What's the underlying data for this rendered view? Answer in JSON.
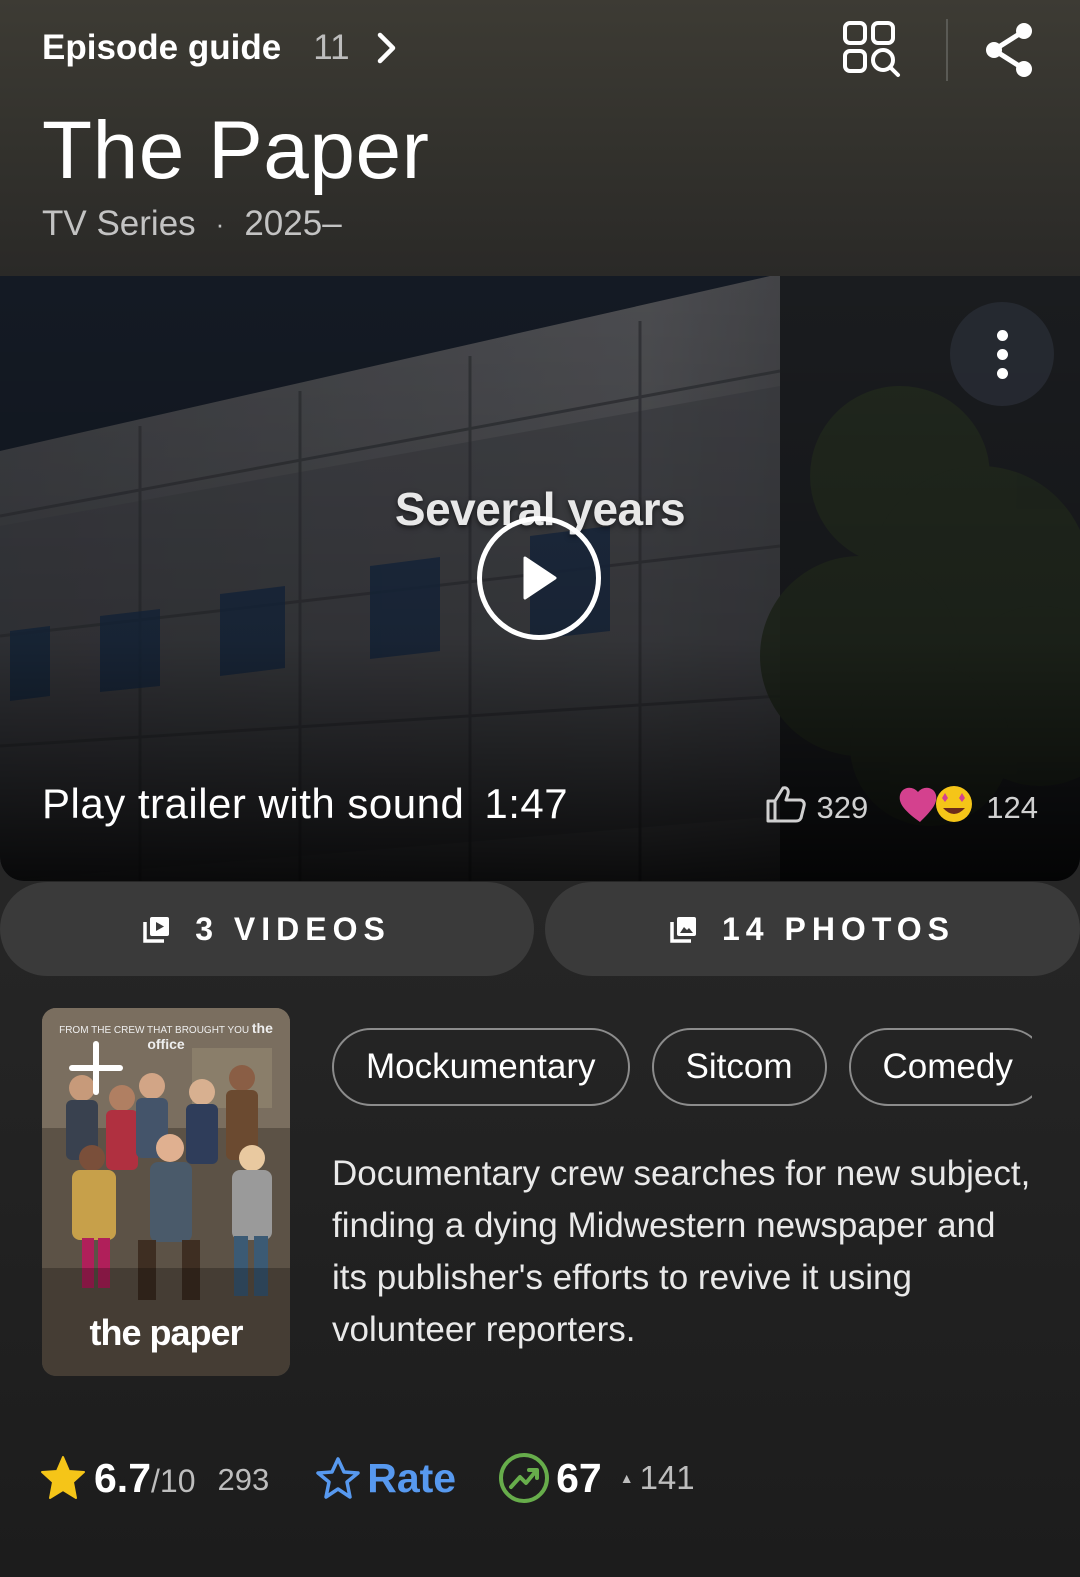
{
  "header": {
    "episode_guide_label": "Episode guide",
    "episode_count": "11",
    "title": "The Paper",
    "type": "TV Series",
    "separator": "·",
    "years": "2025–"
  },
  "video": {
    "overlay_caption": "Several years",
    "trailer_label": "Play trailer with sound",
    "duration": "1:47",
    "likes": "329",
    "reactions": "124"
  },
  "media": {
    "videos_label": "3 VIDEOS",
    "photos_label": "14 PHOTOS"
  },
  "poster": {
    "tagline_small": "FROM THE CREW THAT BROUGHT YOU",
    "tagline_brand": "the office",
    "title_text": "the paper"
  },
  "genres": [
    "Mockumentary",
    "Sitcom",
    "Comedy"
  ],
  "plot": "Documentary crew searches for new subject, finding a dying Midwestern newspaper and its publisher's efforts to revive it using volunteer reporters.",
  "rating": {
    "score": "6.7",
    "out_of": "/10",
    "votes": "293",
    "rate_label": "Rate",
    "popularity": "67",
    "popularity_delta": "141"
  },
  "colors": {
    "accent_blue": "#5799ef",
    "star_yellow": "#f5c518",
    "meter_green": "#67ad4b",
    "heart_pink": "#d4418e"
  }
}
